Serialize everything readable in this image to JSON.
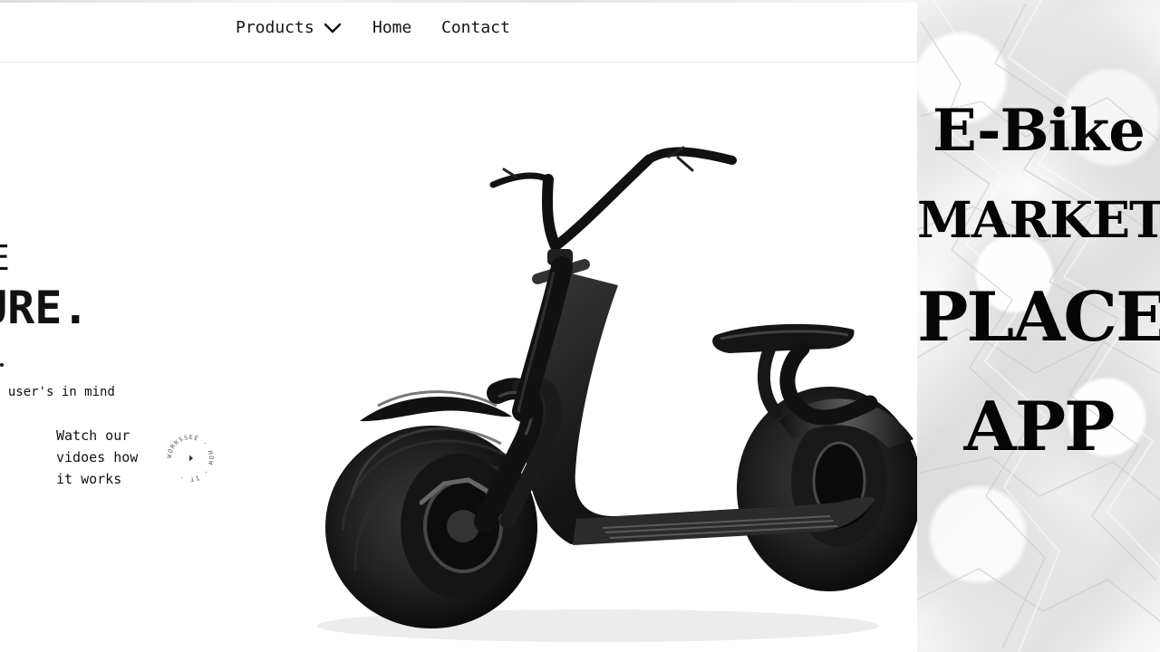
{
  "website": {
    "nav": {
      "products": "Products",
      "home": "Home",
      "contact": "Contact"
    },
    "hero": {
      "line1": "E",
      "line2": "URE.",
      "tagline": "h user's in mind"
    },
    "video": {
      "watch_text": "Watch our\nvidoes how\nit works",
      "badge_text": "WORKSSEE · HOW · IT ·"
    }
  },
  "poster": {
    "words": [
      "E-Bike",
      "MARKET",
      "PLACE",
      "APP"
    ]
  },
  "colors": {
    "text": "#111111",
    "poster_text": "#050505",
    "scooter_dark": "#171717",
    "paper_light": "#f7f7f7"
  }
}
